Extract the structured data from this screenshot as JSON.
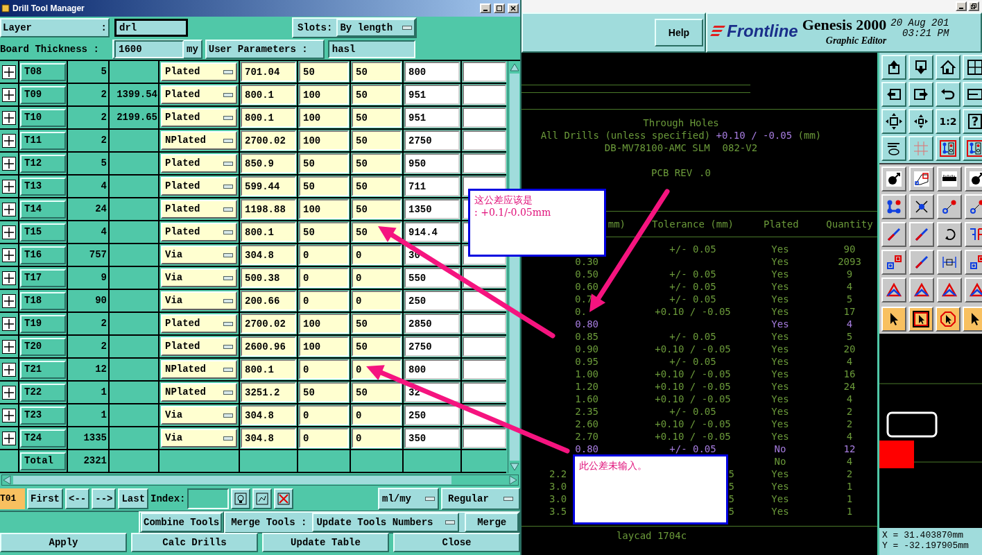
{
  "dialog": {
    "title": "Drill Tool Manager",
    "layer": {
      "label": "Layer",
      "separator": ":",
      "value": "drl",
      "focused": true
    },
    "slots": {
      "label": "Slots:",
      "value": "By length"
    },
    "board_thickness": {
      "label": "Board Thickness :",
      "value": "1600",
      "unit": "my",
      "focused": false
    },
    "user_parameters": {
      "label": "User Parameters :",
      "value": "hasl",
      "focused": false
    },
    "rows": [
      {
        "tool": "T08",
        "column_3": "5",
        "type": "Plated",
        "column_6": "701.04",
        "column_7": "50",
        "column_8": "50",
        "column_9": "800"
      },
      {
        "tool": "T09",
        "column_3": "2",
        "column_4": "1399.54",
        "type": "Plated",
        "column_6": "800.1",
        "column_7": "100",
        "column_8": "50",
        "column_9": "951"
      },
      {
        "tool": "T10",
        "column_3": "2",
        "column_4": "2199.65",
        "type": "Plated",
        "column_6": "800.1",
        "column_7": "100",
        "column_8": "50",
        "column_9": "951"
      },
      {
        "tool": "T11",
        "column_3": "2",
        "type": "NPlated",
        "column_6": "2700.02",
        "column_7": "100",
        "column_8": "50",
        "column_9": "2750"
      },
      {
        "tool": "T12",
        "column_3": "5",
        "type": "Plated",
        "column_6": "850.9",
        "column_7": "50",
        "column_8": "50",
        "column_9": "950"
      },
      {
        "tool": "T13",
        "column_3": "4",
        "type": "Plated",
        "column_6": "599.44",
        "column_7": "50",
        "column_8": "50",
        "column_9": "711"
      },
      {
        "tool": "T14",
        "column_3": "24",
        "type": "Plated",
        "column_6": "1198.88",
        "column_7": "100",
        "column_8": "50",
        "column_9": "1350"
      },
      {
        "tool": "T15",
        "column_3": "4",
        "type": "Plated",
        "column_6": "800.1",
        "column_7": "50",
        "column_8": "50",
        "column_9": "914.4"
      },
      {
        "tool": "T16",
        "column_3": "757",
        "type": "Via",
        "column_6": "304.8",
        "column_7": "0",
        "column_8": "0",
        "column_9": "30"
      },
      {
        "tool": "T17",
        "column_3": "9",
        "type": "Via",
        "column_6": "500.38",
        "column_7": "0",
        "column_8": "0",
        "column_9": "550"
      },
      {
        "tool": "T18",
        "column_3": "90",
        "type": "Via",
        "column_6": "200.66",
        "column_7": "0",
        "column_8": "0",
        "column_9": "250"
      },
      {
        "tool": "T19",
        "column_3": "2",
        "type": "Plated",
        "column_6": "2700.02",
        "column_7": "100",
        "column_8": "50",
        "column_9": "2850"
      },
      {
        "tool": "T20",
        "column_3": "2",
        "type": "Plated",
        "column_6": "2600.96",
        "column_7": "100",
        "column_8": "50",
        "column_9": "2750"
      },
      {
        "tool": "T21",
        "column_3": "12",
        "type": "NPlated",
        "column_6": "800.1",
        "column_7": "0",
        "column_8": "0",
        "column_9": "800"
      },
      {
        "tool": "T22",
        "column_3": "1",
        "type": "NPlated",
        "column_6": "3251.2",
        "column_7": "50",
        "column_8": "50",
        "column_9": "32"
      },
      {
        "tool": "T23",
        "column_3": "1",
        "type": "Via",
        "column_6": "304.8",
        "column_7": "0",
        "column_8": "0",
        "column_9": "250"
      },
      {
        "tool": "T24",
        "column_3": "1335",
        "type": "Via",
        "column_6": "304.8",
        "column_7": "0",
        "column_8": "0",
        "column_9": "350"
      }
    ],
    "total": {
      "label": "Total",
      "value": "2321"
    },
    "current_tool": "T01",
    "nav_buttons": [
      "First",
      "<--",
      "-->",
      "Last"
    ],
    "index_label": "Index:",
    "units": "ml/my",
    "mode": "Regular",
    "combine_button": "Combine Tools",
    "merge_label": "Merge Tools :",
    "merge_option": "Update Tools Numbers",
    "merge_button": "Merge",
    "actions": [
      "Apply",
      "Calc Drills",
      "Update Table",
      "Close"
    ]
  },
  "editor": {
    "help": "Help",
    "brand": "Frontline",
    "product": "Genesis 2000",
    "subtitle": "Graphic Editor",
    "date": "20 Aug 201",
    "time": "03:21 PM",
    "drawing": {
      "title": "Through Holes",
      "spec": [
        {
          "text": "All Drills (unless specified) ",
          "highlighted": false
        },
        {
          "text": "+0.10 / -0.05",
          "highlighted": true
        },
        {
          "text": " (mm)",
          "highlighted": false
        }
      ],
      "part_number": [
        "DB-MV78100-AMC SLM",
        "082-V2"
      ],
      "revision": [
        "PCB REV",
        ".0"
      ],
      "columns": [
        "mm)",
        "Tolerance (mm)",
        "Plated",
        "Quantity"
      ],
      "rows": [
        {
          "kind": "full",
          "tolerance": "+/- 0.05",
          "plated": "Yes",
          "quantity": "90",
          "highlighted": false
        },
        {
          "kind": "full",
          "diameter": "0.30",
          "plated": "Yes",
          "quantity": "2093",
          "highlighted": false
        },
        {
          "kind": "full",
          "diameter": "0.50",
          "tolerance": "+/- 0.05",
          "plated": "Yes",
          "quantity": "9",
          "highlighted": false
        },
        {
          "kind": "full",
          "diameter": "0.60",
          "tolerance": "+/- 0.05",
          "plated": "Yes",
          "quantity": "4",
          "highlighted": false
        },
        {
          "kind": "covered",
          "diameter": "0.7",
          "tolerance": "+/- 0.05",
          "plated": "Yes",
          "quantity": "5",
          "highlighted": false
        },
        {
          "kind": "covered",
          "diameter": "0.",
          "tolerance": "+0.10 / -0.05",
          "plated": "Yes",
          "quantity": "17",
          "highlighted": false
        },
        {
          "kind": "full",
          "diameter": "0.80",
          "plated": "Yes",
          "quantity": "4",
          "highlighted": true
        },
        {
          "kind": "full",
          "diameter": "0.85",
          "tolerance": "+/- 0.05",
          "plated": "Yes",
          "quantity": "5",
          "highlighted": false
        },
        {
          "kind": "full",
          "diameter": "0.90",
          "tolerance": "+0.10 / -0.05",
          "plated": "Yes",
          "quantity": "20",
          "highlighted": false
        },
        {
          "kind": "full",
          "diameter": "0.95",
          "tolerance": "+/- 0.05",
          "plated": "Yes",
          "quantity": "4",
          "highlighted": false
        },
        {
          "kind": "full",
          "diameter": "1.00",
          "tolerance": "+0.10 / -0.05",
          "plated": "Yes",
          "quantity": "16",
          "highlighted": false
        },
        {
          "kind": "full",
          "diameter": "1.20",
          "tolerance": "+0.10 / -0.05",
          "plated": "Yes",
          "quantity": "24",
          "highlighted": false
        },
        {
          "kind": "full",
          "diameter": "1.60",
          "tolerance": "+0.10 / -0.05",
          "plated": "Yes",
          "quantity": "4",
          "highlighted": false
        },
        {
          "kind": "full",
          "diameter": "2.35",
          "tolerance": "+/- 0.05",
          "plated": "Yes",
          "quantity": "2",
          "highlighted": false
        },
        {
          "kind": "full",
          "diameter": "2.60",
          "tolerance": "+0.10 / -0.05",
          "plated": "Yes",
          "quantity": "2",
          "highlighted": false
        },
        {
          "kind": "full",
          "diameter": "2.70",
          "tolerance": "+0.10 / -0.05",
          "plated": "Yes",
          "quantity": "4",
          "highlighted": false
        },
        {
          "kind": "full",
          "diameter": "0.80",
          "tolerance": "+/- 0.05",
          "plated": "No",
          "quantity": "12",
          "highlighted": true
        },
        {
          "kind": "full",
          "plated": "No",
          "quantity": "4",
          "highlighted": false
        },
        {
          "kind": "clipped",
          "diameter": "2.2",
          "tolerance": "5",
          "plated": "Yes",
          "quantity": "2",
          "highlighted": false
        },
        {
          "kind": "clipped",
          "diameter": "3.0",
          "tolerance": "5",
          "plated": "Yes",
          "quantity": "1",
          "highlighted": false
        },
        {
          "kind": "clipped",
          "diameter": "3.0",
          "tolerance": "5",
          "plated": "Yes",
          "quantity": "1",
          "highlighted": false
        },
        {
          "kind": "clipped",
          "diameter": "3.5",
          "tolerance": "5",
          "plated": "Yes",
          "quantity": "1",
          "highlighted": false
        }
      ],
      "footer": "laycad 1704c"
    },
    "toolbar": {
      "ratio": "1:2",
      "help": "?"
    },
    "coordinates": [
      "X = 31.403870mm",
      "Y = -32.197905mm"
    ]
  },
  "annotations": [
    {
      "lines": [
        "这公差应该是",
        ": +0.1/-0.05mm"
      ]
    },
    {
      "lines": [
        "此公差未输入。"
      ]
    }
  ]
}
